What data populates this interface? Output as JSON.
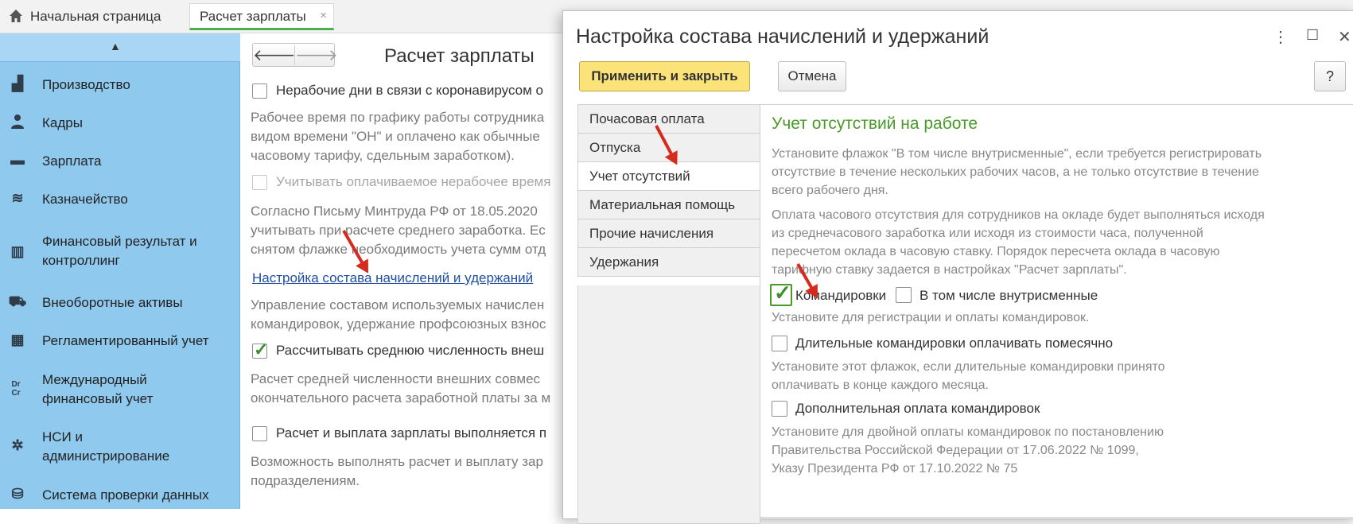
{
  "tabs": {
    "home": "Начальная страница",
    "active": "Расчет зарплаты",
    "close": "×"
  },
  "sidebar": {
    "items": [
      {
        "icon": "production-icon",
        "glyph": "▟",
        "label": "Производство"
      },
      {
        "icon": "person-icon",
        "glyph": "👤",
        "label": "Кадры"
      },
      {
        "icon": "wallet-icon",
        "glyph": "▬",
        "label": "Зарплата"
      },
      {
        "icon": "coins-icon",
        "glyph": "≋",
        "label": "Казначейство"
      },
      {
        "icon": "bar-chart-icon",
        "glyph": "▥",
        "label": "Финансовый результат и",
        "label2": "контроллинг"
      },
      {
        "icon": "car-icon",
        "glyph": "⛟",
        "label": "Внеоборотные активы"
      },
      {
        "icon": "calculator-icon",
        "glyph": "▦",
        "label": "Регламентированный учет"
      },
      {
        "icon": "drcr-icon",
        "glyph": "Dr Cr",
        "label": "Международный",
        "label2": "финансовый учет"
      },
      {
        "icon": "gear-icon",
        "glyph": "✲",
        "label": "НСИ и",
        "label2": "администрирование"
      },
      {
        "icon": "database-icon",
        "glyph": "⛁",
        "label": "Система проверки данных"
      }
    ]
  },
  "main": {
    "title": "Расчет зарплаты",
    "back": "🡐",
    "forward": "🡒",
    "cb1_label": "Нерабочие дни в связи с коронавирусом о",
    "desc1": [
      "Рабочее время по графику работы сотрудника",
      "видом времени \"ОН\" и оплачено как обычные",
      "часовому тарифу, сдельным заработком)."
    ],
    "cb2_label": "Учитывать оплачиваемое нерабочее время",
    "desc2": [
      "Согласно Письму Минтруда РФ от 18.05.2020",
      "учитывать при расчете среднего заработка. Ес",
      "снятом флажке необходимость учета сумм отд"
    ],
    "link": "Настройка состава начислений и удержаний",
    "desc3": [
      "Управление составом используемых начислен",
      "командировок, удержание профсоюзных взнос"
    ],
    "cb3_label": "Рассчитывать среднюю численность внеш",
    "desc4": [
      "Расчет средней численности внешних совмес",
      "окончательного расчета заработной платы за м"
    ],
    "cb4_label": "Расчет и выплата зарплаты выполняется п",
    "desc5": [
      "Возможность выполнять расчет и выплату зар",
      "подразделениям."
    ]
  },
  "dialog": {
    "title": "Настройка состава начислений и удержаний",
    "more": "⋮",
    "maximize": "☐",
    "close": "✕",
    "apply": "Применить и закрыть",
    "cancel": "Отмена",
    "help": "?",
    "tabs": [
      "Почасовая оплата",
      "Отпуска",
      "Учет отсутствий",
      "Материальная помощь",
      "Прочие начисления",
      "Удержания"
    ],
    "active_tab": "Учет отсутствий",
    "panel": {
      "title": "Учет отсутствий на работе",
      "p1": [
        "Установите флажок \"В том числе внутрисменные\", если требуется регистрировать",
        "отсутствие в течение нескольких рабочих часов, а не только отсутствие в течение",
        "всего рабочего дня."
      ],
      "p2": [
        "Оплата часового отсутствия для сотрудников на окладе будет выполняться исходя",
        "из среднечасового заработка или исходя из стоимости часа, полученной",
        "пересчетом оклада в часовую ставку. Порядок пересчета оклада в часовую",
        "тарифную ставку задается в настройках \"Расчет зарплаты\"."
      ],
      "cb_trips": "Командировки",
      "cb_intra": "В том числе внутрисменные",
      "h_trips": "Установите для регистрации и оплаты командировок.",
      "cb_long": "Длительные командировки оплачивать помесячно",
      "h_long": [
        "Установите этот флажок, если длительные командировки принято",
        "оплачивать в конце каждого месяца."
      ],
      "cb_extra": "Дополнительная оплата командировок",
      "h_extra": [
        "Установите для двойной оплаты командировок по постановлению",
        "Правительства Российской Федерации от 17.06.2022 № 1099,",
        "Указу Президента РФ от 17.10.2022 № 75"
      ]
    }
  },
  "colors": {
    "sidebar": "#8fc9ee",
    "apply_button": "#fbe37a",
    "section_title": "#4a9a28",
    "arrow": "#d62a1e",
    "link": "#1f4ea1"
  }
}
